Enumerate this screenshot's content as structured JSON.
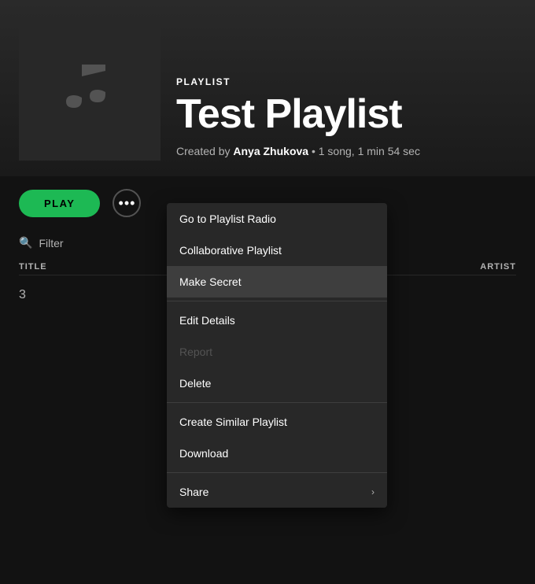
{
  "header": {
    "playlist_type": "PLAYLIST",
    "playlist_title": "Test Playlist",
    "created_by_prefix": "Created by ",
    "creator_name": "Anya Zhukova",
    "meta_suffix": "• 1 song, 1 min 54 sec"
  },
  "controls": {
    "play_label": "PLAY",
    "more_dots": "···"
  },
  "filter": {
    "placeholder": "Filter"
  },
  "table": {
    "col_title": "TITLE",
    "col_artist": "ARTIST",
    "track_number": "3"
  },
  "context_menu": {
    "items": [
      {
        "id": "playlist-radio",
        "label": "Go to Playlist Radio",
        "disabled": false,
        "has_arrow": false,
        "highlighted": false
      },
      {
        "id": "collaborative",
        "label": "Collaborative Playlist",
        "disabled": false,
        "has_arrow": false,
        "highlighted": false
      },
      {
        "id": "make-secret",
        "label": "Make Secret",
        "disabled": false,
        "has_arrow": false,
        "highlighted": true
      },
      {
        "id": "edit-details",
        "label": "Edit Details",
        "disabled": false,
        "has_arrow": false,
        "highlighted": false
      },
      {
        "id": "report",
        "label": "Report",
        "disabled": true,
        "has_arrow": false,
        "highlighted": false
      },
      {
        "id": "delete",
        "label": "Delete",
        "disabled": false,
        "has_arrow": false,
        "highlighted": false
      },
      {
        "id": "create-similar",
        "label": "Create Similar Playlist",
        "disabled": false,
        "has_arrow": false,
        "highlighted": false
      },
      {
        "id": "download",
        "label": "Download",
        "disabled": false,
        "has_arrow": false,
        "highlighted": false
      },
      {
        "id": "share",
        "label": "Share",
        "disabled": false,
        "has_arrow": true,
        "highlighted": false
      }
    ],
    "divider_after": [
      2,
      4,
      6,
      7
    ]
  },
  "colors": {
    "play_green": "#1db954",
    "bg_dark": "#121212",
    "bg_card": "#282828",
    "text_muted": "#b3b3b3",
    "highlight_bg": "#3e3e3e"
  }
}
